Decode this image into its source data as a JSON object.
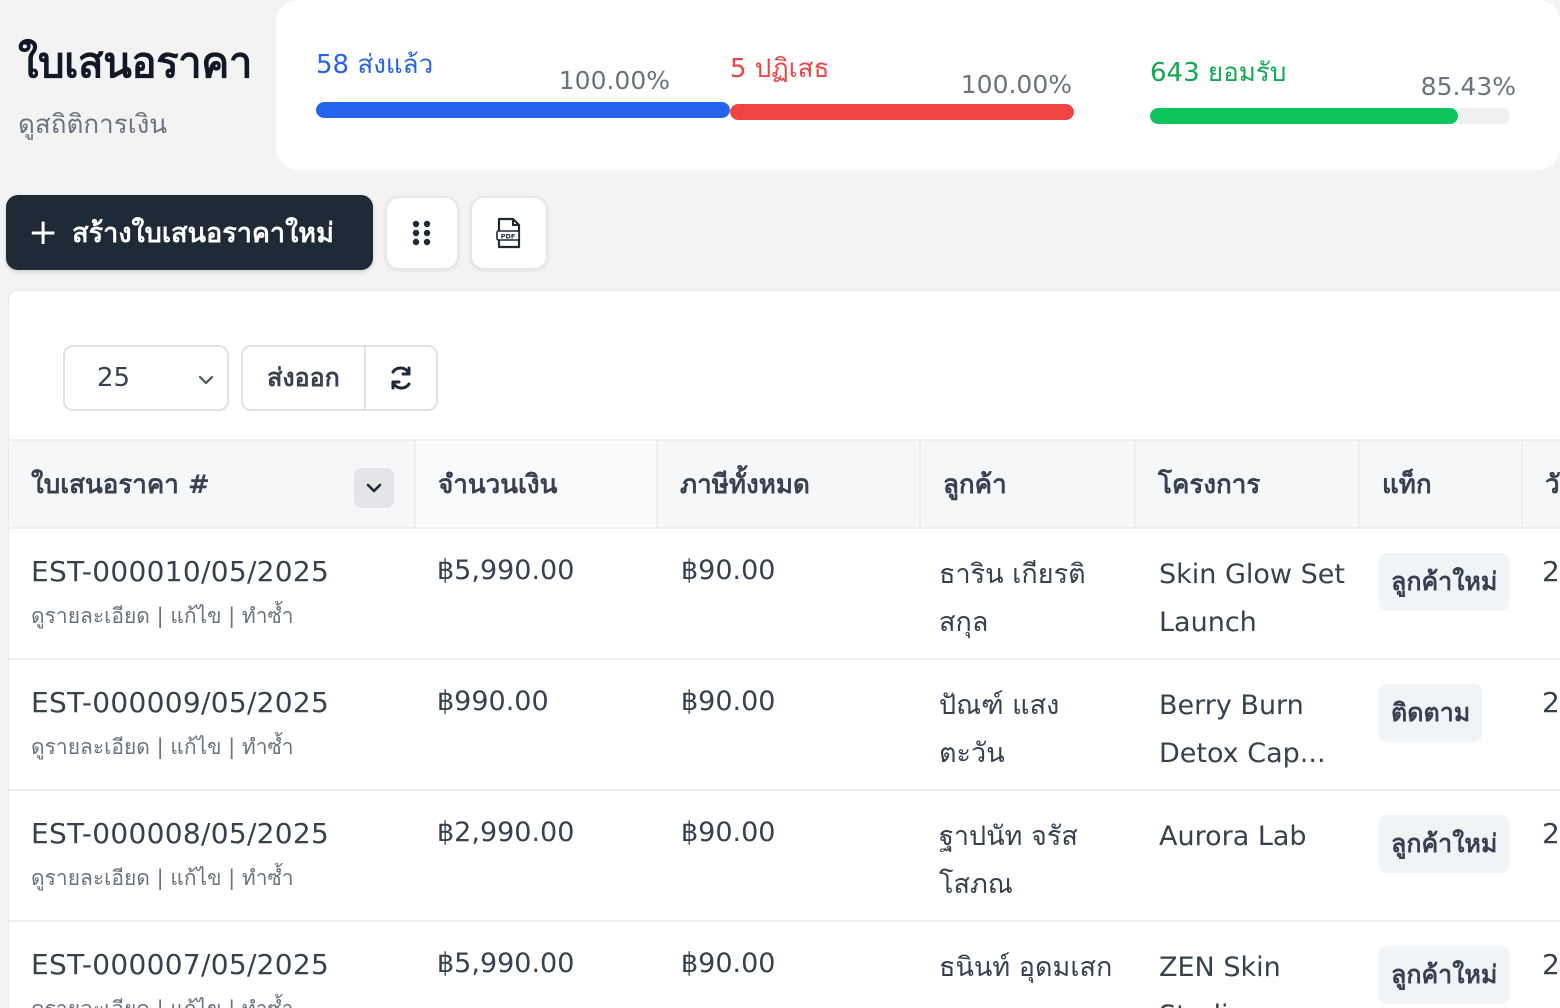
{
  "header": {
    "title": "ใบเสนอราคา",
    "subtitle": "ดูสถิติการเงิน"
  },
  "stats": [
    {
      "label": "58 ส่งแล้ว",
      "percent": "100.00%",
      "fill_fraction": 1.0,
      "color": "#2563eb"
    },
    {
      "label": "5 ปฏิเสธ",
      "percent": "100.00%",
      "fill_fraction": 1.0,
      "color": "#ef4444"
    },
    {
      "label": "643 ยอมรับ",
      "percent": "85.43%",
      "fill_fraction": 0.8543,
      "color": "#10c45c"
    }
  ],
  "toolbar": {
    "create_label": "สร้างใบเสนอราคาใหม่",
    "create_icon": "plus-icon",
    "columns_icon": "grid-dots-icon",
    "pdf_icon": "pdf-file-icon"
  },
  "table_controls": {
    "page_size": "25",
    "export_label": "ส่งออก",
    "refresh_icon": "refresh-icon"
  },
  "table": {
    "columns": [
      "ใบเสนอราคา #",
      "จำนวนเงิน",
      "ภาษีทั้งหมด",
      "ลูกค้า",
      "โครงการ",
      "แท็ก",
      "วั"
    ],
    "action_links": "ดูรายละเอียด | แก้ไข | ทำซ้ำ",
    "rows": [
      {
        "number": "EST-000010/05/2025",
        "amount": "฿5,990.00",
        "tax": "฿90.00",
        "customer": "ธาริน เกียรติสกุล",
        "project": "Skin Glow Set Launch",
        "tag": "ลูกค้าใหม่",
        "date": "2"
      },
      {
        "number": "EST-000009/05/2025",
        "amount": "฿990.00",
        "tax": "฿90.00",
        "customer": "ปัณฑ์ แสงตะวัน",
        "project": "Berry Burn Detox Cap...",
        "tag": "ติดตาม",
        "date": "2"
      },
      {
        "number": "EST-000008/05/2025",
        "amount": "฿2,990.00",
        "tax": "฿90.00",
        "customer": "ฐาปนัท จรัสโสภณ",
        "project": "Aurora Lab",
        "tag": "ลูกค้าใหม่",
        "date": "2"
      },
      {
        "number": "EST-000007/05/2025",
        "amount": "฿5,990.00",
        "tax": "฿90.00",
        "customer": "ธนินท์ อุดมเสก",
        "project": "ZEN Skin Studio",
        "tag": "ลูกค้าใหม่",
        "date": "2"
      }
    ]
  }
}
